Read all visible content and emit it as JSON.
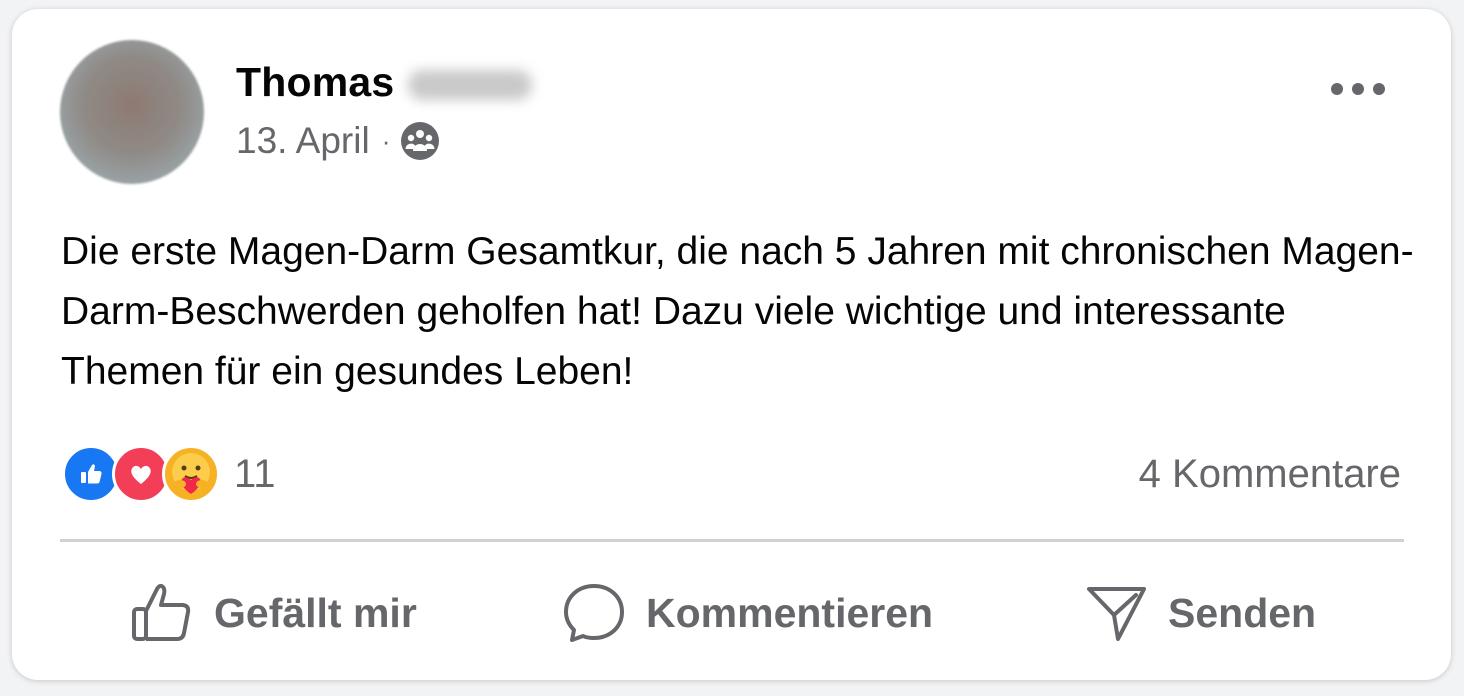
{
  "post": {
    "author": {
      "first_name": "Thomas",
      "last_name_redacted": true
    },
    "date": "13. April",
    "separator": "·",
    "audience_icon": "friends-icon",
    "text": "Die erste Magen-Darm Gesamtkur, die nach 5 Jahren mit chronischen Magen-Darm-Beschwerden geholfen hat! Dazu viele wichtige und interessante Themen für ein gesundes Leben!"
  },
  "reactions": {
    "icons": [
      "like-reaction-icon",
      "love-reaction-icon",
      "care-reaction-icon"
    ],
    "count": "11"
  },
  "comments": {
    "label": "4 Kommentare"
  },
  "actions": {
    "like": {
      "label": "Gefällt mir",
      "icon": "thumbs-up-icon"
    },
    "comment": {
      "label": "Kommentieren",
      "icon": "comment-bubble-icon"
    },
    "send": {
      "label": "Senden",
      "icon": "send-icon"
    }
  },
  "colors": {
    "like_blue": "#1877f2",
    "love_red": "#f33e58",
    "care_yellow": "#f7b125",
    "secondary_text": "#65676b",
    "primary_text": "#050505"
  }
}
